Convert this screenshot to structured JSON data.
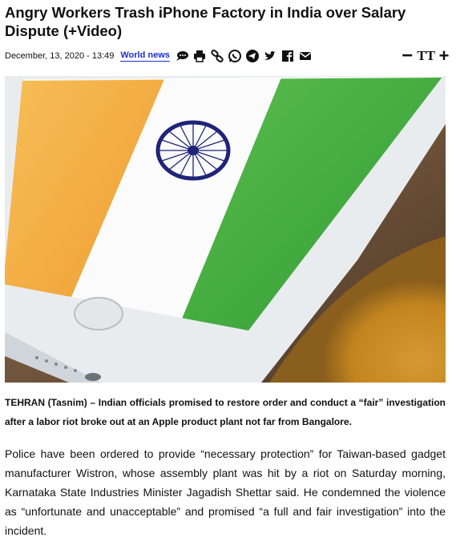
{
  "article": {
    "title": "Angry Workers Trash iPhone Factory in India over Salary Dispute (+Video)",
    "date": "December, 13, 2020 - 13:49",
    "category": "World news",
    "lead": "TEHRAN (Tasnim) – Indian officials promised to restore order and conduct a “fair” investigation after a labor riot broke out at an Apple product plant not far from Bangalore.",
    "body": "Police have been ordered to provide “necessary protection” for Taiwan-based gadget manufacturer Wistron, whose assembly plant was hit by a riot on Saturday morning, Karnataka State Industries Minister Jagadish Shettar said. He condemned the violence as “unfortunate and unacceptable” and promised “a full and fair investigation” into the incident."
  },
  "share_icons": [
    "comment-icon",
    "print-icon",
    "link-icon",
    "whatsapp-icon",
    "telegram-icon",
    "twitter-icon",
    "facebook-icon",
    "email-icon"
  ],
  "font_controls": {
    "decrease": "−",
    "size": "TT",
    "increase": "+"
  },
  "colors": {
    "category_link": "#1a2fd0",
    "flag_saffron": "#f2a637",
    "flag_green": "#34a33a",
    "chakra_navy": "#1e2478"
  }
}
